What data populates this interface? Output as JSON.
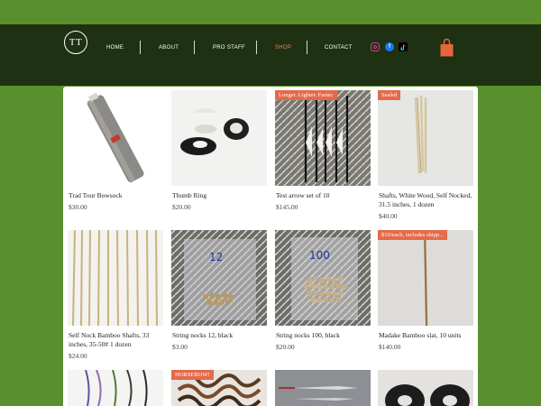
{
  "brand": {
    "logo_text": "TT"
  },
  "nav": {
    "items": [
      {
        "label": "HOME",
        "active": false
      },
      {
        "label": "ABOUT",
        "active": false
      },
      {
        "label": "PRO STAFF",
        "active": false
      },
      {
        "label": "SHOP",
        "active": true
      },
      {
        "label": "CONTACT",
        "active": false
      }
    ]
  },
  "social": [
    {
      "icon": "instagram-icon"
    },
    {
      "icon": "facebook-icon"
    },
    {
      "icon": "tiktok-icon"
    }
  ],
  "cart": {
    "icon": "shopping-bag-icon",
    "color": "#e8643c"
  },
  "colors": {
    "page_bg": "#5a8f2e",
    "header_bg": "#1e3112",
    "ribbon": "#e46a4a",
    "active_nav": "#e88a60"
  },
  "products": [
    {
      "name": "Trad Tour Bowsock",
      "price": "$30.00",
      "ribbon": ""
    },
    {
      "name": "Thumb Ring",
      "price": "$20.00",
      "ribbon": ""
    },
    {
      "name": "Test arrow set of 10",
      "price": "$145.00",
      "ribbon": "Longer. Lighter. Faster."
    },
    {
      "name": "Shafts, White Wood, Self Nocked, 31.5 inches, 1 dozen",
      "price": "$40.00",
      "ribbon": "Sealed"
    },
    {
      "name": "Self Nock Bamboo Shafts, 33 inches, 35-50# 1 dozen",
      "price": "$24.00",
      "ribbon": ""
    },
    {
      "name": "String nocks 12, black",
      "price": "$3.00",
      "ribbon": ""
    },
    {
      "name": "String nocks 100, black",
      "price": "$20.00",
      "ribbon": ""
    },
    {
      "name": "Madake Bamboo slat, 10 units",
      "price": "$140.00",
      "ribbon": "$10/each, includes shipp..."
    },
    {
      "name": "",
      "price": "",
      "ribbon": ""
    },
    {
      "name": "",
      "price": "",
      "ribbon": "HORSEBOW!"
    },
    {
      "name": "",
      "price": "",
      "ribbon": ""
    },
    {
      "name": "",
      "price": "",
      "ribbon": ""
    }
  ]
}
